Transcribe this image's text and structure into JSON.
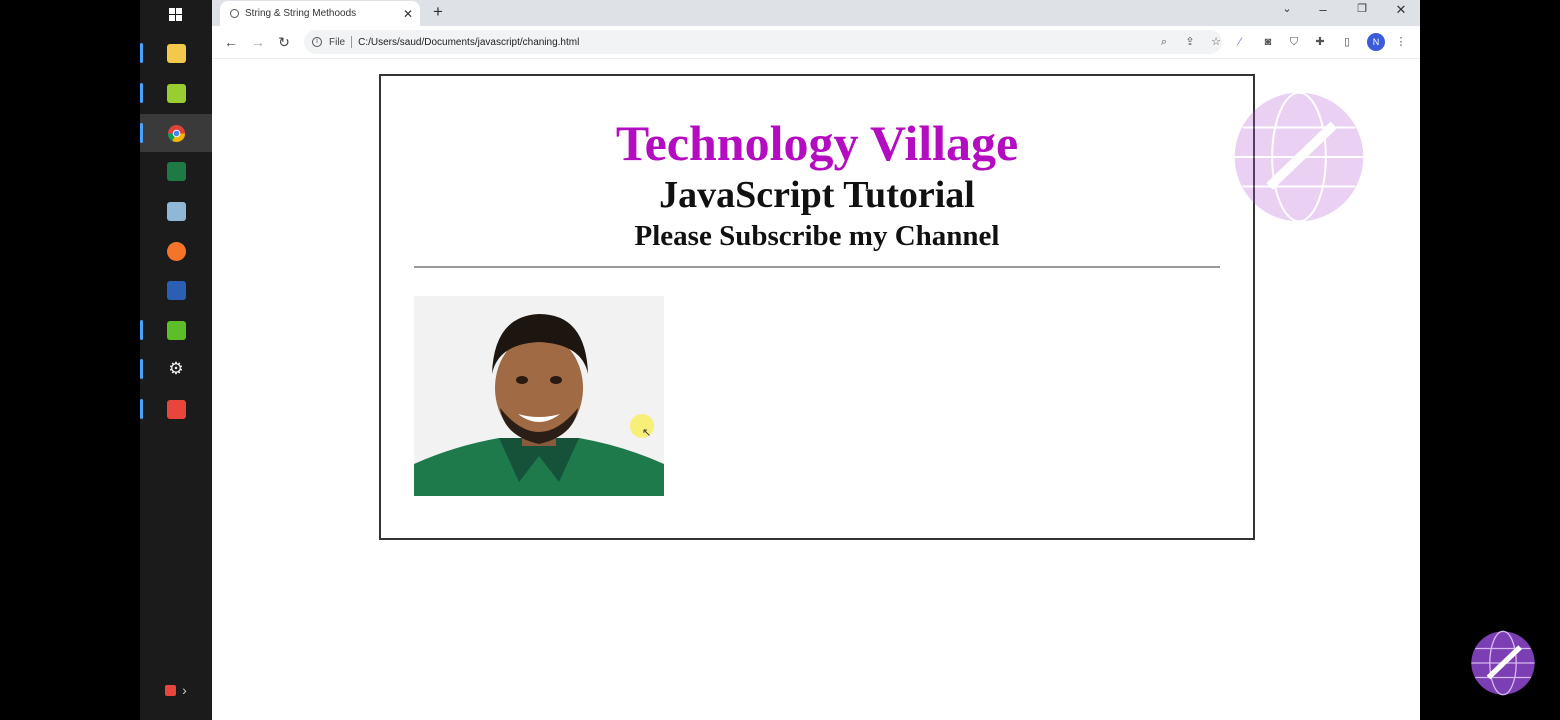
{
  "browser": {
    "tab": {
      "title": "String & String Methoods"
    },
    "address": {
      "scheme": "File",
      "url": "C:/Users/saud/Documents/javascript/chaning.html"
    },
    "profile_initial": "N"
  },
  "page": {
    "title": "Technology Village",
    "subtitle": "JavaScript Tutorial",
    "subscribe_text": "Please Subscribe my Channel"
  },
  "taskbar": {
    "apps": [
      "windows-start",
      "file-explorer",
      "notepad",
      "chrome",
      "excel",
      "app",
      "firefox",
      "word",
      "camtasia",
      "settings",
      "recorder"
    ]
  },
  "colors": {
    "title": "#b40cc0",
    "accent": "#3b5bdb",
    "jersey": "#1e7a4a"
  }
}
